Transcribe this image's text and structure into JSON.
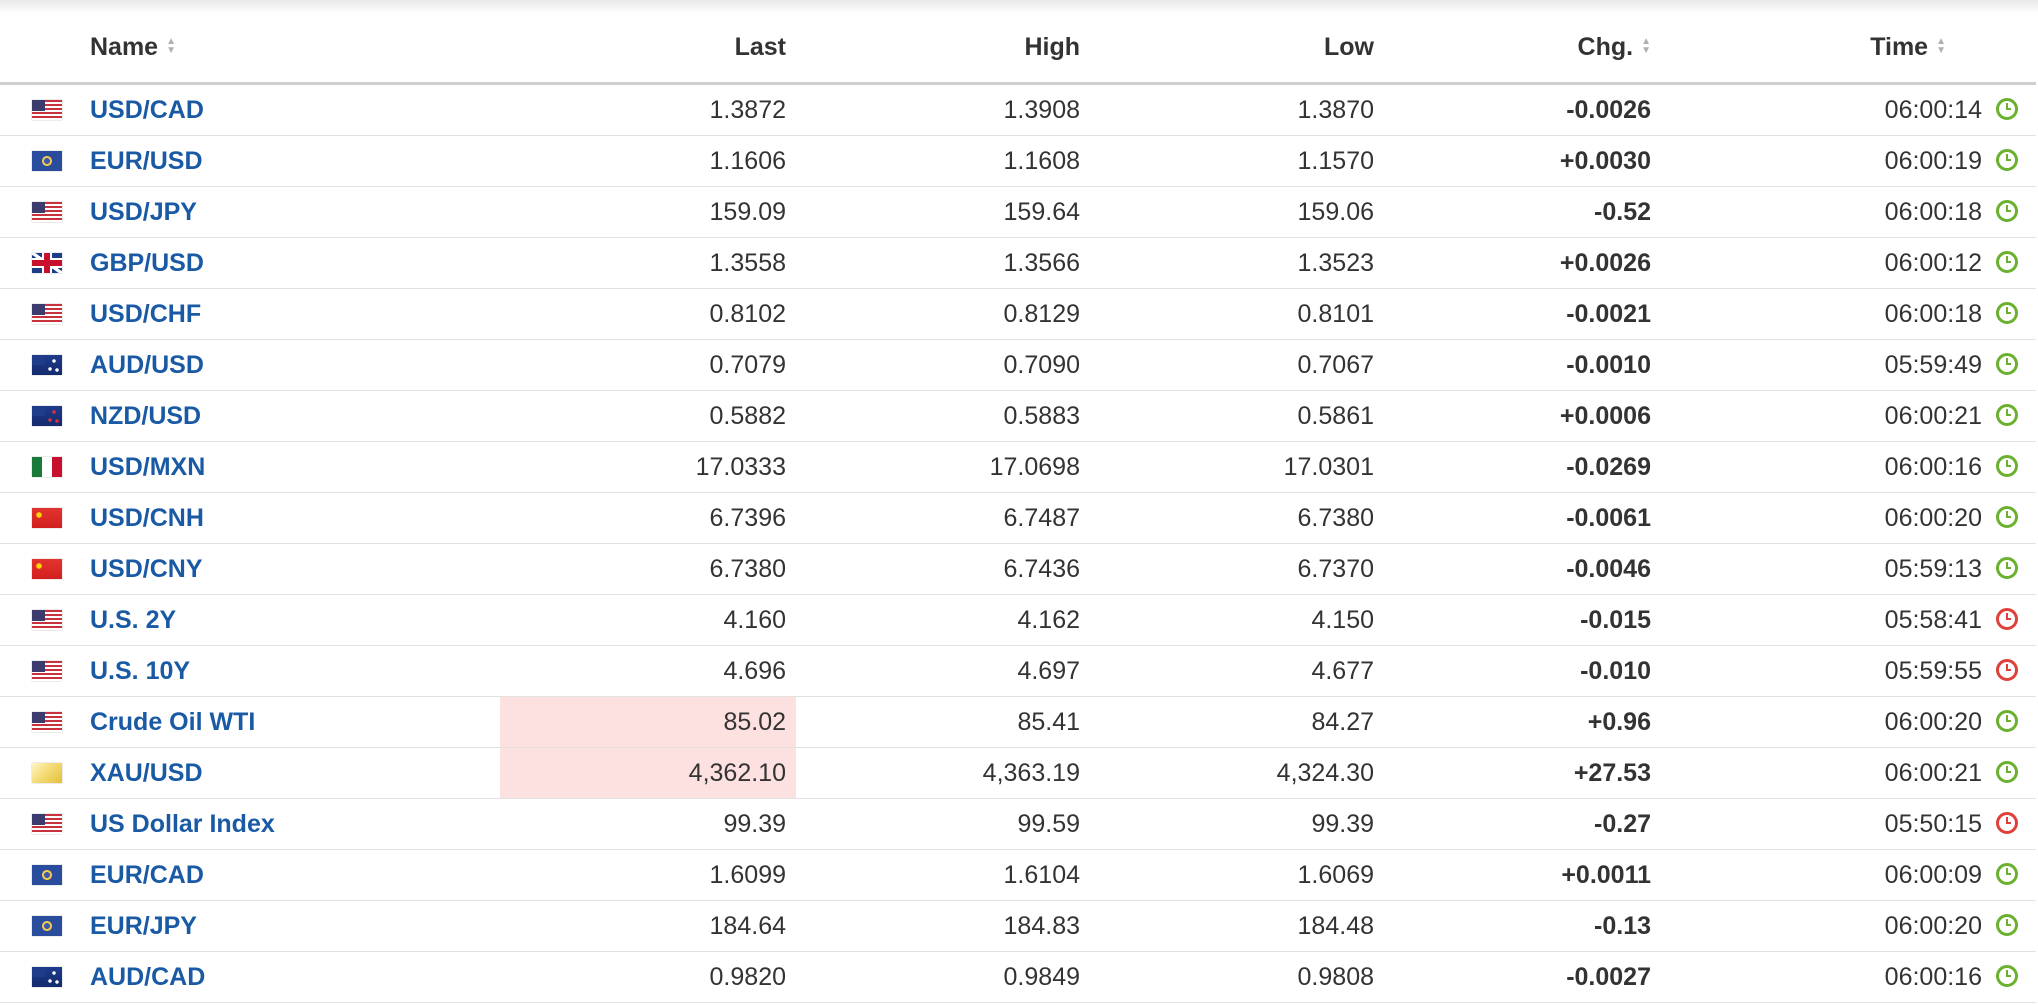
{
  "columns": {
    "name": "Name",
    "last": "Last",
    "high": "High",
    "low": "Low",
    "chg": "Chg.",
    "time": "Time"
  },
  "colors": {
    "link": "#1a5aa5",
    "negative": "#e00000",
    "positive": "#11a30d",
    "highlight": "#fde0e0",
    "clock_live": "#6bb02e",
    "clock_delayed": "#e0403a"
  },
  "rows": [
    {
      "flag": "us-flag",
      "name": "USD/CAD",
      "last": "1.3872",
      "high": "1.3908",
      "low": "1.3870",
      "chg": "-0.0026",
      "time": "06:00:14",
      "clock": "green"
    },
    {
      "flag": "eu-flag",
      "name": "EUR/USD",
      "last": "1.1606",
      "high": "1.1608",
      "low": "1.1570",
      "chg": "+0.0030",
      "time": "06:00:19",
      "clock": "green"
    },
    {
      "flag": "us-flag",
      "name": "USD/JPY",
      "last": "159.09",
      "high": "159.64",
      "low": "159.06",
      "chg": "-0.52",
      "time": "06:00:18",
      "clock": "green"
    },
    {
      "flag": "gb-flag",
      "name": "GBP/USD",
      "last": "1.3558",
      "high": "1.3566",
      "low": "1.3523",
      "chg": "+0.0026",
      "time": "06:00:12",
      "clock": "green"
    },
    {
      "flag": "us-flag",
      "name": "USD/CHF",
      "last": "0.8102",
      "high": "0.8129",
      "low": "0.8101",
      "chg": "-0.0021",
      "time": "06:00:18",
      "clock": "green"
    },
    {
      "flag": "au-flag",
      "name": "AUD/USD",
      "last": "0.7079",
      "high": "0.7090",
      "low": "0.7067",
      "chg": "-0.0010",
      "time": "05:59:49",
      "clock": "green"
    },
    {
      "flag": "nz-flag",
      "name": "NZD/USD",
      "last": "0.5882",
      "high": "0.5883",
      "low": "0.5861",
      "chg": "+0.0006",
      "time": "06:00:21",
      "clock": "green"
    },
    {
      "flag": "mx-flag",
      "name": "USD/MXN",
      "last": "17.0333",
      "high": "17.0698",
      "low": "17.0301",
      "chg": "-0.0269",
      "time": "06:00:16",
      "clock": "green"
    },
    {
      "flag": "cn-flag",
      "name": "USD/CNH",
      "last": "6.7396",
      "high": "6.7487",
      "low": "6.7380",
      "chg": "-0.0061",
      "time": "06:00:20",
      "clock": "green"
    },
    {
      "flag": "cn-flag",
      "name": "USD/CNY",
      "last": "6.7380",
      "high": "6.7436",
      "low": "6.7370",
      "chg": "-0.0046",
      "time": "05:59:13",
      "clock": "green"
    },
    {
      "flag": "us-flag",
      "name": "U.S. 2Y",
      "last": "4.160",
      "high": "4.162",
      "low": "4.150",
      "chg": "-0.015",
      "time": "05:58:41",
      "clock": "red"
    },
    {
      "flag": "us-flag",
      "name": "U.S. 10Y",
      "last": "4.696",
      "high": "4.697",
      "low": "4.677",
      "chg": "-0.010",
      "time": "05:59:55",
      "clock": "red"
    },
    {
      "flag": "us-flag",
      "name": "Crude Oil WTI",
      "last": "85.02",
      "high": "85.41",
      "low": "84.27",
      "chg": "+0.96",
      "time": "06:00:20",
      "clock": "green",
      "last_highlight": true
    },
    {
      "flag": "gold-flag",
      "name": "XAU/USD",
      "last": "4,362.10",
      "high": "4,363.19",
      "low": "4,324.30",
      "chg": "+27.53",
      "time": "06:00:21",
      "clock": "green",
      "last_highlight": true
    },
    {
      "flag": "us-flag",
      "name": "US Dollar Index",
      "last": "99.39",
      "high": "99.59",
      "low": "99.39",
      "chg": "-0.27",
      "time": "05:50:15",
      "clock": "red"
    },
    {
      "flag": "eu-flag",
      "name": "EUR/CAD",
      "last": "1.6099",
      "high": "1.6104",
      "low": "1.6069",
      "chg": "+0.0011",
      "time": "06:00:09",
      "clock": "green"
    },
    {
      "flag": "eu-flag",
      "name": "EUR/JPY",
      "last": "184.64",
      "high": "184.83",
      "low": "184.48",
      "chg": "-0.13",
      "time": "06:00:20",
      "clock": "green"
    },
    {
      "flag": "au-flag",
      "name": "AUD/CAD",
      "last": "0.9820",
      "high": "0.9849",
      "low": "0.9808",
      "chg": "-0.0027",
      "time": "06:00:16",
      "clock": "green"
    }
  ]
}
